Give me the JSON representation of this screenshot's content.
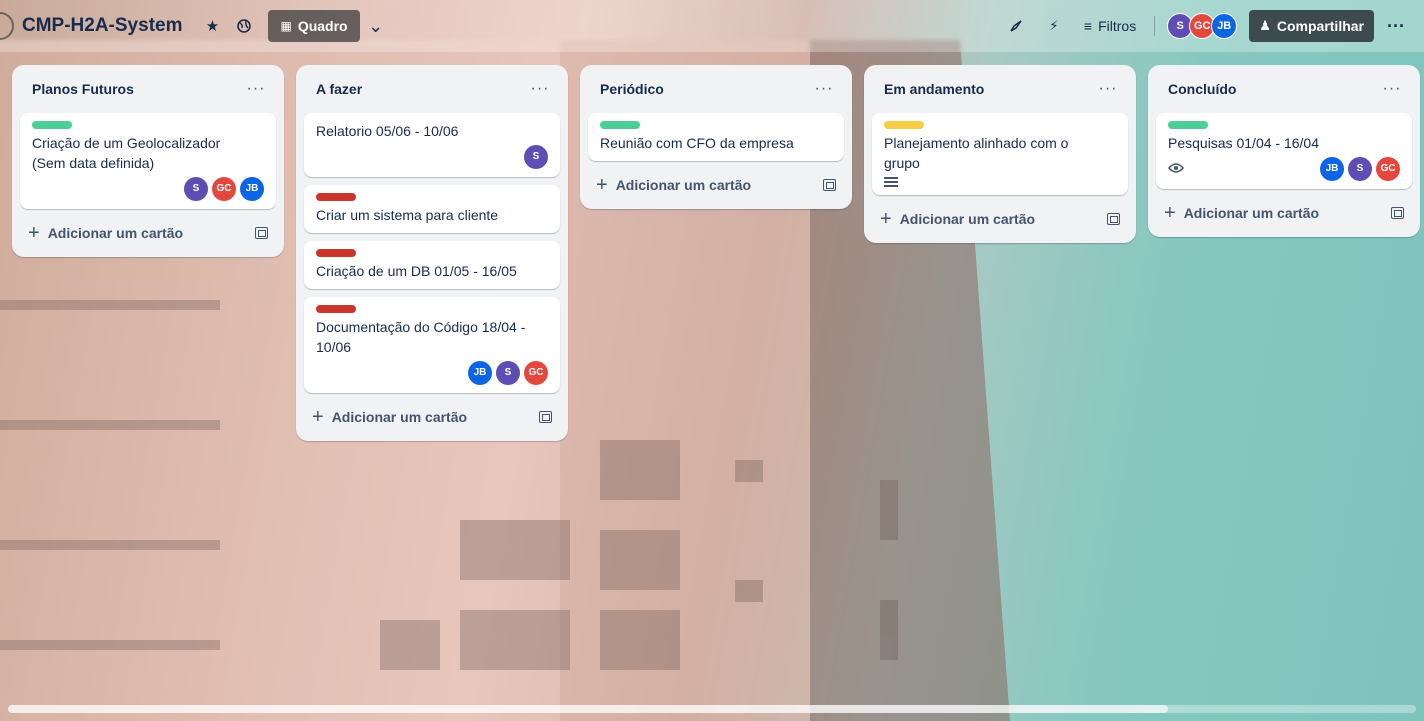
{
  "header": {
    "board_title": "CMP-H2A-System",
    "view_label": "Quadro",
    "filters_label": "Filtros",
    "share_label": "Compartilhar",
    "members": [
      {
        "initials": "S",
        "color": "#5e4db2"
      },
      {
        "initials": "GC",
        "color": "#e2483d"
      },
      {
        "initials": "JB",
        "color": "#0c66e4"
      }
    ]
  },
  "colors": {
    "label_green": "#4bce97",
    "label_red": "#c9372c",
    "label_yellow": "#f5cd47",
    "avatar_s": "#5e4db2",
    "avatar_gc": "#e2483d",
    "avatar_jb": "#0c66e4"
  },
  "lists": [
    {
      "title": "Planos Futuros",
      "cards": [
        {
          "title": "Criação de um Geolocalizador (Sem data definida)",
          "label": "label_green",
          "members": [
            "S",
            "GC",
            "JB"
          ]
        }
      ],
      "add_label": "Adicionar um cartão"
    },
    {
      "title": "A fazer",
      "cards": [
        {
          "title": "Relatorio 05/06 - 10/06",
          "members": [
            "S"
          ]
        },
        {
          "title": "Criar um sistema para cliente",
          "label": "label_red"
        },
        {
          "title": "Criação de um DB 01/05 - 16/05",
          "label": "label_red"
        },
        {
          "title": "Documentação do Código 18/04 - 10/06",
          "label": "label_red",
          "members": [
            "JB",
            "S",
            "GC"
          ]
        }
      ],
      "add_label": "Adicionar um cartão"
    },
    {
      "title": "Periódico",
      "cards": [
        {
          "title": "Reunião com CFO da empresa",
          "label": "label_green"
        }
      ],
      "add_label": "Adicionar um cartão"
    },
    {
      "title": "Em andamento",
      "cards": [
        {
          "title": "Planejamento alinhado com o grupo",
          "label": "label_yellow",
          "description_icon": "description-icon"
        }
      ],
      "add_label": "Adicionar um cartão"
    },
    {
      "title": "Concluído",
      "cards": [
        {
          "title": "Pesquisas 01/04 - 16/04",
          "label": "label_green",
          "watch_icon": "eye-icon",
          "members": [
            "JB",
            "S",
            "GC"
          ]
        }
      ],
      "add_label": "Adicionar um cartão"
    }
  ]
}
